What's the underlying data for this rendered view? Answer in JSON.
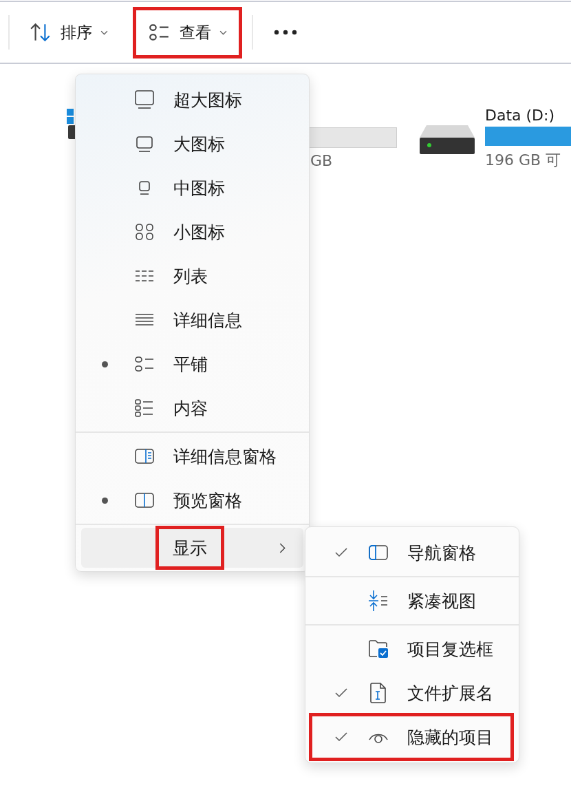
{
  "toolbar": {
    "buttons": [
      {
        "kind": "sort",
        "label": "排序",
        "annotated": false
      },
      {
        "kind": "view",
        "label": "查看",
        "annotated": true
      },
      {
        "kind": "more",
        "annotated": false
      }
    ]
  },
  "drives": [
    {
      "free": "GB"
    },
    {
      "name": "Data (D:)",
      "free": "196 GB 可",
      "level": 1
    }
  ],
  "view_menu": {
    "groups": [
      {
        "items": [
          {
            "kind": "xl",
            "label": "超大图标",
            "selected": false
          },
          {
            "kind": "large",
            "label": "大图标",
            "selected": false
          },
          {
            "kind": "medium",
            "label": "中图标",
            "selected": false
          },
          {
            "kind": "small",
            "label": "小图标",
            "selected": false
          },
          {
            "kind": "list",
            "label": "列表",
            "selected": false
          },
          {
            "kind": "details",
            "label": "详细信息",
            "selected": false
          },
          {
            "kind": "tiles",
            "label": "平铺",
            "selected": true
          },
          {
            "kind": "content",
            "label": "内容",
            "selected": false
          }
        ]
      },
      {
        "items": [
          {
            "kind": "details-pane",
            "label": "详细信息窗格",
            "selected": false
          },
          {
            "kind": "preview-pane",
            "label": "预览窗格",
            "selected": true
          }
        ]
      },
      {
        "items": [
          {
            "kind": "submenu",
            "label": "显示",
            "expanded": true,
            "annotated": true
          }
        ]
      }
    ]
  },
  "show_submenu": {
    "groups": [
      {
        "items": [
          {
            "kind": "nav-pane",
            "label": "导航窗格",
            "checked": true,
            "annotated": false
          }
        ]
      },
      {
        "items": [
          {
            "kind": "compact",
            "label": "紧凑视图",
            "checked": false,
            "annotated": false
          }
        ]
      },
      {
        "items": [
          {
            "kind": "checkboxes",
            "label": "项目复选框",
            "checked": false,
            "annotated": false
          },
          {
            "kind": "extensions",
            "label": "文件扩展名",
            "checked": true,
            "annotated": false
          },
          {
            "kind": "hidden",
            "label": "隐藏的项目",
            "checked": true,
            "annotated": true
          }
        ]
      }
    ]
  }
}
